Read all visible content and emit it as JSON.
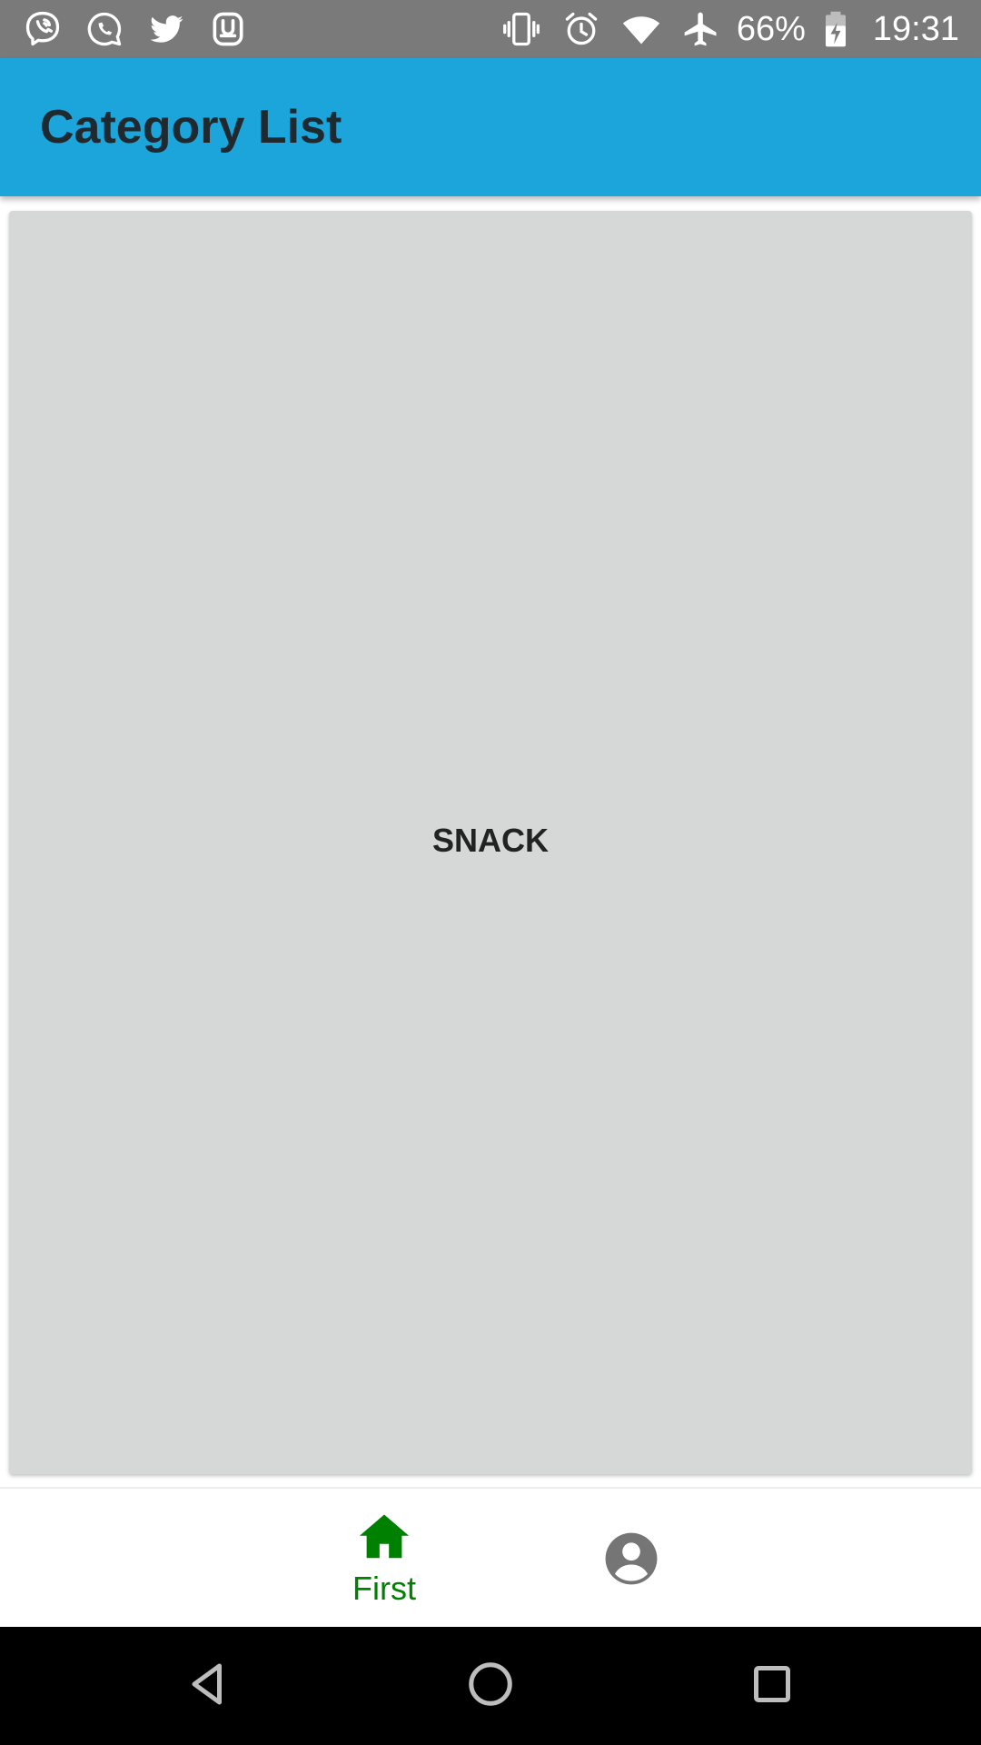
{
  "status_bar": {
    "left_icons": [
      "viber-icon",
      "whatsapp-icon",
      "twitter-icon",
      "tab-app-icon"
    ],
    "right_icons": [
      "vibrate-icon",
      "alarm-icon",
      "wifi-icon",
      "airplane-mode-icon"
    ],
    "battery_percent": "66%",
    "battery_icon": "battery-charging-icon",
    "time": "19:31"
  },
  "app_bar": {
    "title": "Category List",
    "color": "#1ba5db"
  },
  "categories": [
    {
      "label": "SNACK"
    }
  ],
  "bottom_nav": {
    "items": [
      {
        "label": "First",
        "icon": "home-icon",
        "active": true,
        "color": "#008000"
      },
      {
        "label": "",
        "icon": "account-circle-icon",
        "active": false,
        "color": "#757575"
      }
    ]
  },
  "system_nav": {
    "buttons": [
      "back-triangle-icon",
      "home-circle-icon",
      "recents-square-icon"
    ]
  }
}
